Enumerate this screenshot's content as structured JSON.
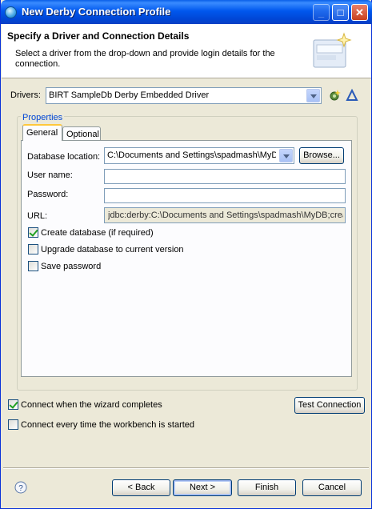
{
  "window": {
    "title": "New Derby Connection Profile"
  },
  "header": {
    "title": "Specify a Driver and Connection Details",
    "description": "Select a driver from the drop-down and provide login details for the connection."
  },
  "drivers": {
    "label": "Drivers:",
    "selected": "BIRT SampleDb Derby Embedded Driver"
  },
  "properties": {
    "group_title": "Properties",
    "tabs": [
      {
        "label": "General",
        "active": true
      },
      {
        "label": "Optional",
        "active": false
      }
    ],
    "database_location": {
      "label": "Database location:",
      "value": "C:\\Documents and Settings\\spadmash\\MyDB",
      "browse_label": "Browse..."
    },
    "user_name": {
      "label": "User name:",
      "value": ""
    },
    "password": {
      "label": "Password:",
      "value": ""
    },
    "url": {
      "label": "URL:",
      "value": "jdbc:derby:C:\\Documents and Settings\\spadmash\\MyDB;create=true"
    },
    "checks": [
      {
        "label": "Create database (if required)",
        "checked": true
      },
      {
        "label": "Upgrade database to current version",
        "checked": false
      },
      {
        "label": "Save password",
        "checked": false
      }
    ]
  },
  "bottom": {
    "connect_when_complete": {
      "label": "Connect when the wizard completes",
      "checked": true
    },
    "connect_every_time": {
      "label": "Connect every time the workbench is started",
      "checked": false
    },
    "test_connection": "Test Connection"
  },
  "footer": {
    "back": "< Back",
    "next": "Next >",
    "finish": "Finish",
    "cancel": "Cancel"
  }
}
